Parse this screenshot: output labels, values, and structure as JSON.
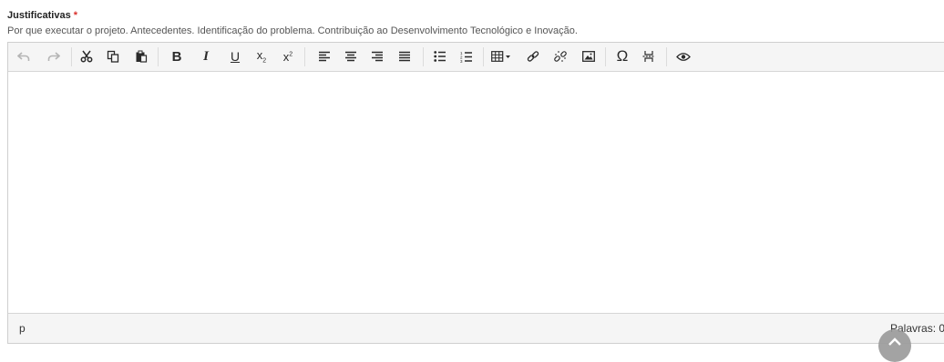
{
  "field": {
    "label": "Justificativas",
    "required_mark": "*",
    "help": "Por que executar o projeto. Antecedentes. Identificação do problema. Contribuição ao Desenvolvimento Tecnológico e Inovação."
  },
  "toolbar": {
    "bold": "B",
    "italic": "I",
    "underline": "U",
    "subscript": "x",
    "superscript": "x",
    "special_char": "Ω",
    "icons": [
      "undo-icon",
      "redo-icon",
      "cut-icon",
      "copy-icon",
      "paste-icon",
      "bold-icon",
      "italic-icon",
      "underline-icon",
      "subscript-icon",
      "superscript-icon",
      "align-left-icon",
      "align-center-icon",
      "align-right-icon",
      "align-justify-icon",
      "bullet-list-icon",
      "numbered-list-icon",
      "table-icon",
      "link-icon",
      "unlink-icon",
      "image-icon",
      "special-char-icon",
      "page-break-icon",
      "preview-icon"
    ]
  },
  "status": {
    "path": "p",
    "wordcount": "Palavras: 0"
  },
  "colors": {
    "required": "#d9302c",
    "toolbar_bg": "#f5f5f5",
    "border": "#cfcfcf"
  }
}
